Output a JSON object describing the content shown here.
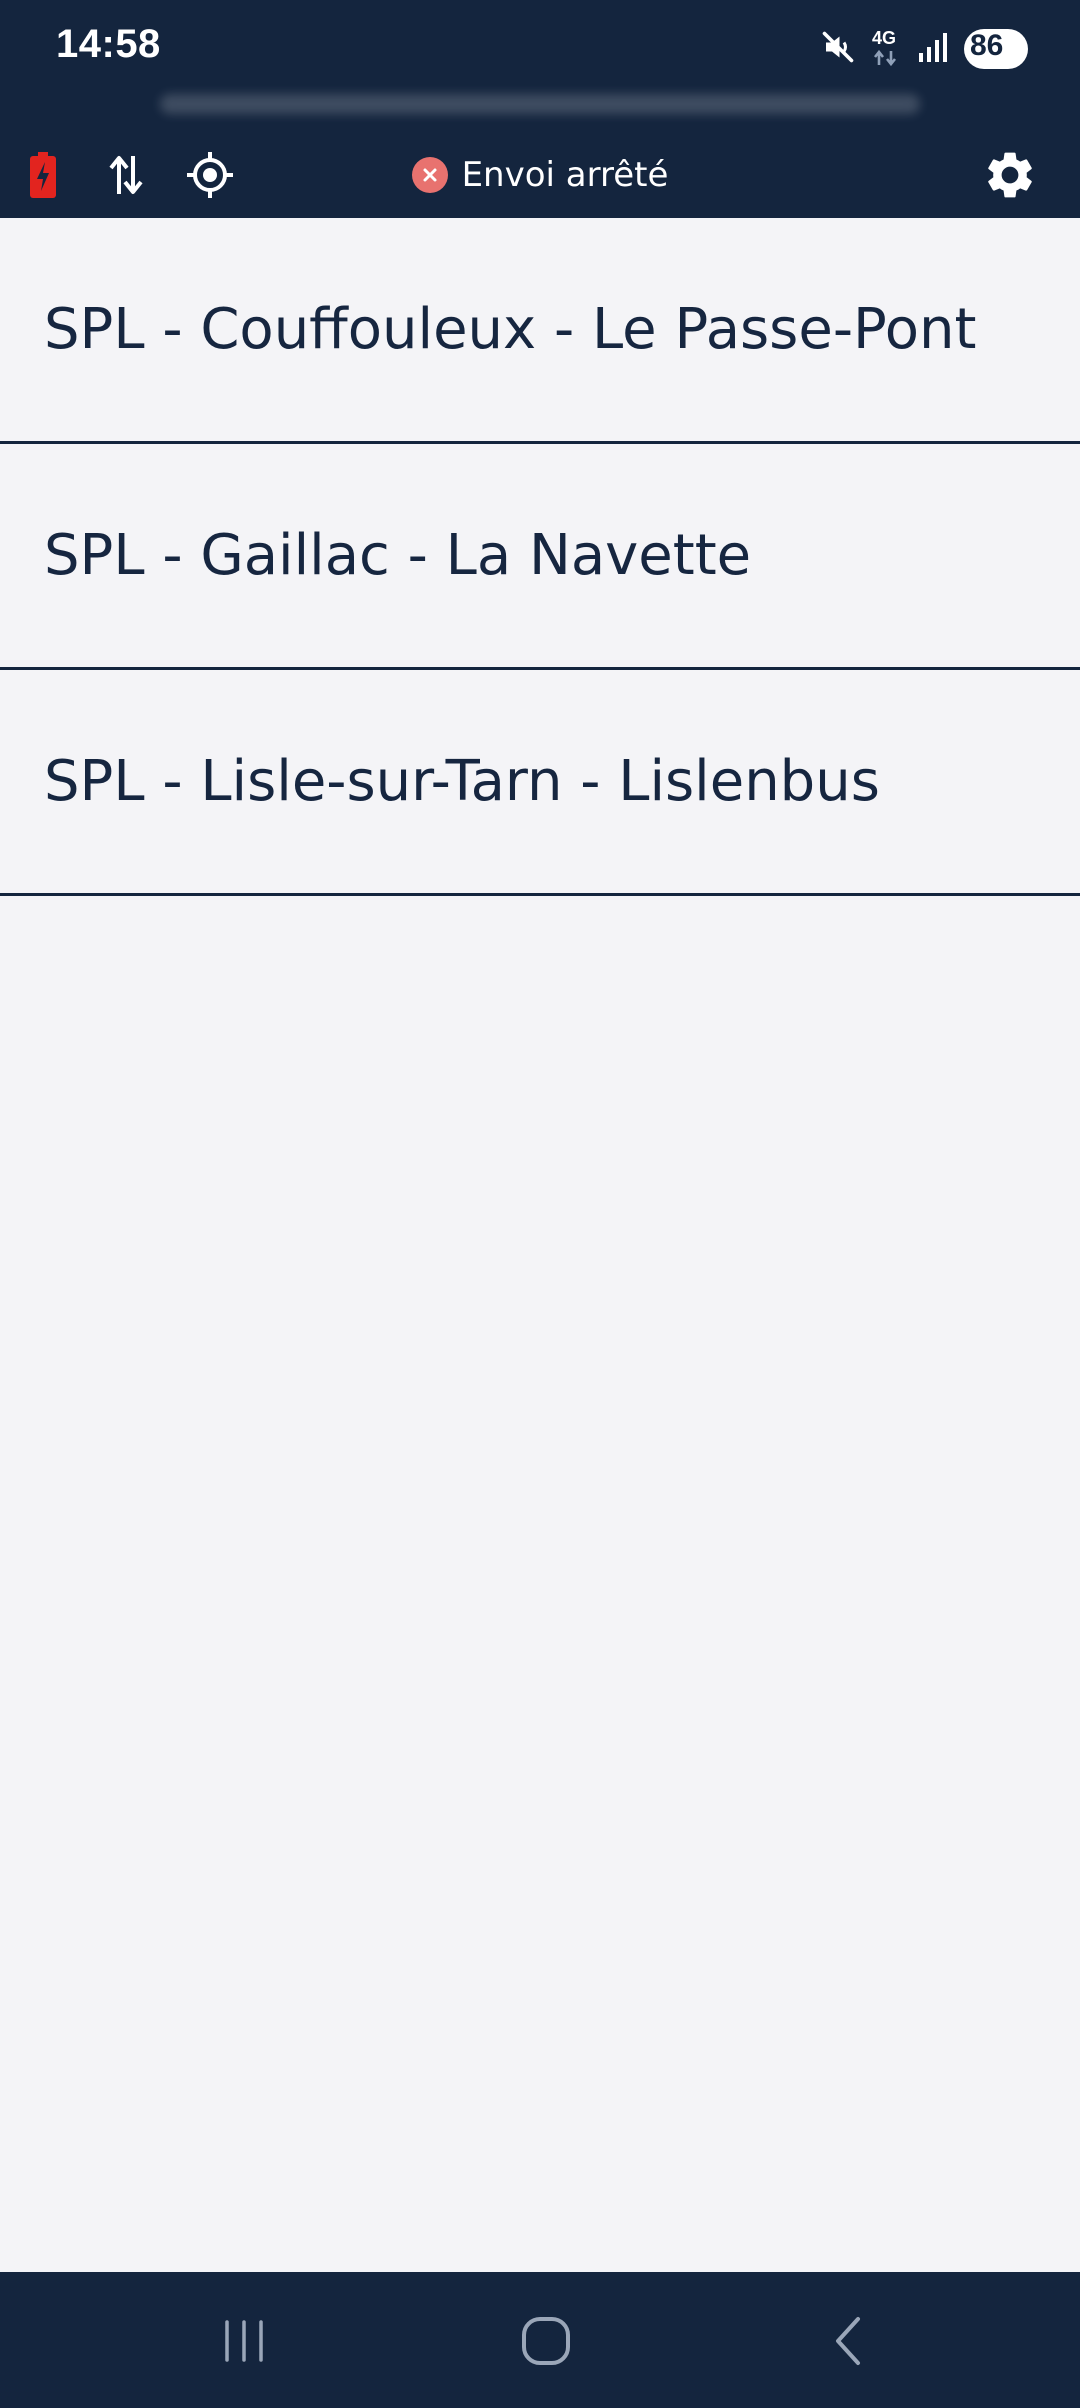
{
  "status_bar": {
    "time": "14:58",
    "network_label": "4G",
    "battery_level": "86",
    "icons": [
      "mute-icon",
      "network-4g-icon",
      "signal-icon",
      "battery-icon"
    ]
  },
  "toolbar": {
    "sending_status": "Envoi arrêté",
    "icons": [
      "battery-alert-icon",
      "sync-arrows-icon",
      "gps-target-icon",
      "status-stop-icon",
      "settings-gear-icon"
    ]
  },
  "lines": [
    {
      "label": "SPL - Couffouleux - Le Passe-Pont"
    },
    {
      "label": "SPL - Gaillac - La Navette"
    },
    {
      "label": "SPL - Lisle-sur-Tarn - Lislenbus"
    }
  ],
  "nav_bar": {
    "icons": [
      "recent-apps-icon",
      "home-icon",
      "back-icon"
    ]
  },
  "colors": {
    "header_bg": "#14253e",
    "page_bg": "#f4f4f7",
    "text": "#162640",
    "alert_red": "#e8726f",
    "battery_red": "#e2241f"
  }
}
